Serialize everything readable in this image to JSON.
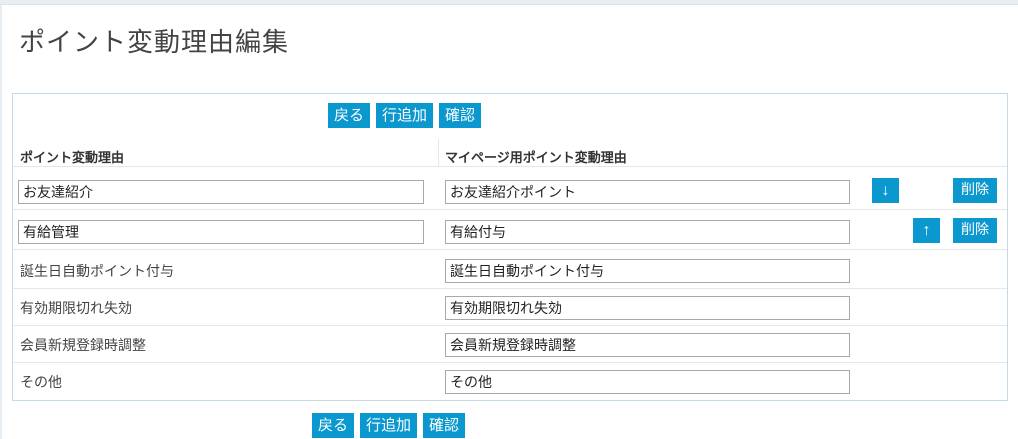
{
  "page": {
    "title": "ポイント変動理由編集"
  },
  "actions": {
    "back": "戻る",
    "add_row": "行追加",
    "confirm": "確認"
  },
  "table": {
    "headers": [
      "ポイント変動理由",
      "マイページ用ポイント変動理由"
    ],
    "rows": [
      {
        "reason": "お友達紹介",
        "mypage_reason": "お友達紹介ポイント",
        "move": "↓",
        "delete": "削除"
      },
      {
        "reason": "有給管理",
        "mypage_reason": "有給付与",
        "move": "↑",
        "delete": "削除"
      },
      {
        "reason": "誕生日自動ポイント付与",
        "mypage_reason": "誕生日自動ポイント付与"
      },
      {
        "reason": "有効期限切れ失効",
        "mypage_reason": "有効期限切れ失効"
      },
      {
        "reason": "会員新規登録時調整",
        "mypage_reason": "会員新規登録時調整"
      },
      {
        "reason": "その他",
        "mypage_reason": "その他"
      }
    ]
  },
  "colors": {
    "accent": "#0a98cf",
    "panel_border": "#c5d9e6"
  }
}
